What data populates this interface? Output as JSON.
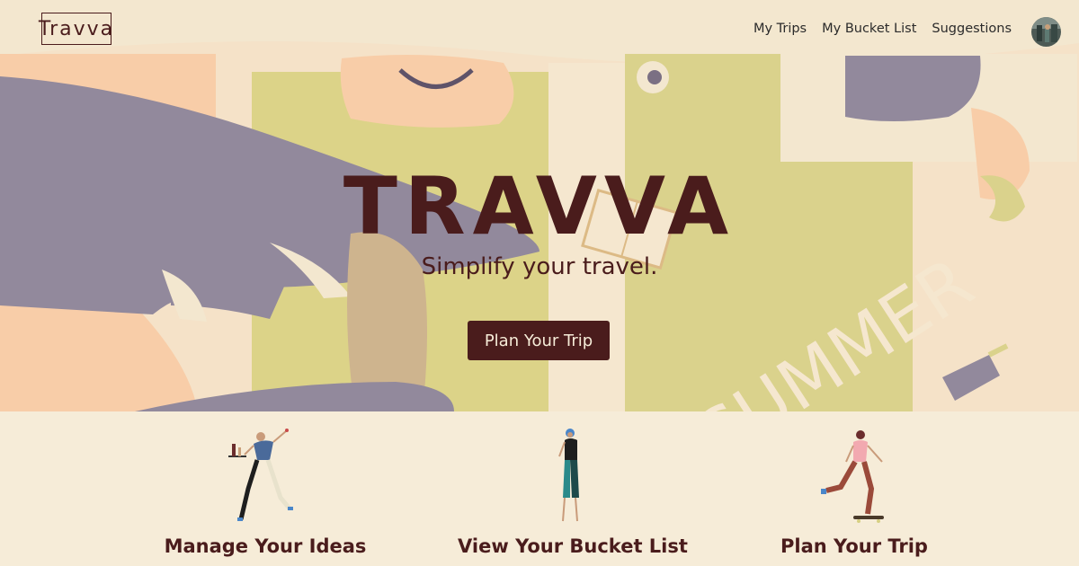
{
  "brand": {
    "logo_text": "Travva"
  },
  "nav": {
    "links": [
      {
        "label": "My Trips"
      },
      {
        "label": "My Bucket List"
      },
      {
        "label": "Suggestions"
      }
    ]
  },
  "hero": {
    "title": "TRAVVA",
    "subtitle": "Simplify your travel.",
    "cta_label": "Plan Your Trip",
    "illustration_text": "SUMMER"
  },
  "features": [
    {
      "label": "Manage Your Ideas",
      "icon": "waiter-figure-icon"
    },
    {
      "label": "View Your Bucket List",
      "icon": "standing-figure-icon"
    },
    {
      "label": "Plan Your Trip",
      "icon": "skateboarder-figure-icon"
    }
  ],
  "colors": {
    "background": "#f6ecd8",
    "brand_dark": "#4a1c1c",
    "olive": "#d6cf82",
    "purple_gray": "#8a7f93",
    "peach": "#f9c9a2"
  }
}
